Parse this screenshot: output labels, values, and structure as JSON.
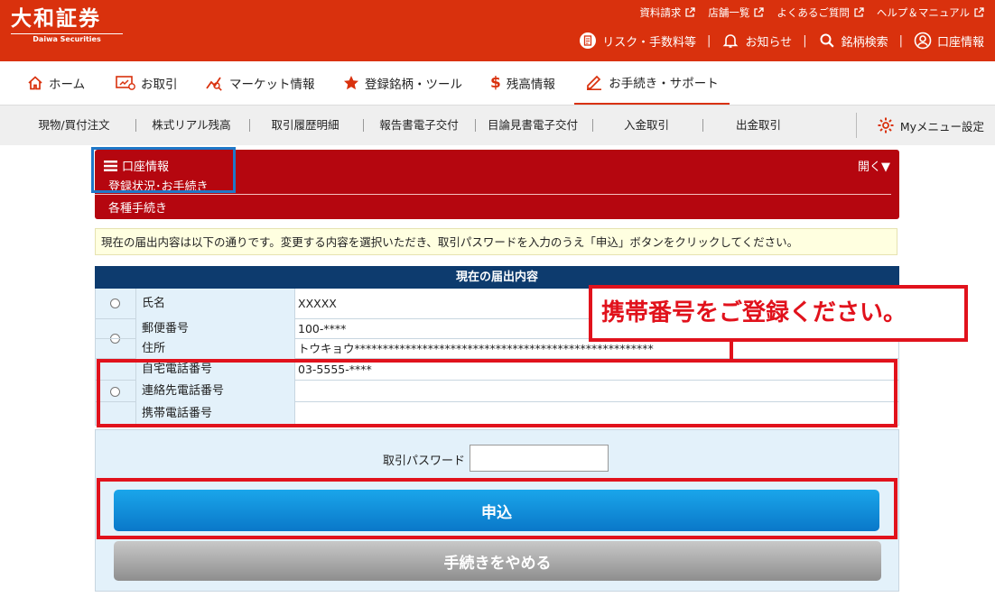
{
  "brand": {
    "name_jp": "大和証券",
    "name_en": "Daiwa Securities"
  },
  "header": {
    "top_links": [
      "資料請求",
      "店舗一覧",
      "よくあるご質問",
      "ヘルプ＆マニュアル"
    ],
    "utils": {
      "risk": "リスク・手数料等",
      "notice": "お知らせ",
      "search": "銘柄検索",
      "account": "口座情報"
    }
  },
  "nav": {
    "items": [
      {
        "label": "ホーム",
        "icon": "home-icon"
      },
      {
        "label": "お取引",
        "icon": "trade-icon"
      },
      {
        "label": "マーケット情報",
        "icon": "market-icon"
      },
      {
        "label": "登録銘柄・ツール",
        "icon": "star-icon"
      },
      {
        "label": "残高情報",
        "icon": "dollar-icon"
      },
      {
        "label": "お手続き・サポート",
        "icon": "pencil-icon"
      }
    ]
  },
  "subnav": {
    "items": [
      "現物/買付注文",
      "株式リアル残高",
      "取引履歴明細",
      "報告書電子交付",
      "目論見書電子交付",
      "入金取引",
      "出金取引"
    ],
    "mymenu": "Myメニュー設定"
  },
  "account_panel": {
    "title": "口座情報",
    "sub1": "登録状況･お手続き",
    "sub2": "各種手続き",
    "open_label": "開く▼"
  },
  "notice_text": "現在の届出内容は以下の通りです。変更する内容を選択いただき、取引パスワードを入力のうえ「申込」ボタンをクリックしてください。",
  "table": {
    "header": "現在の届出内容",
    "name": {
      "label": "氏名",
      "value": "XXXXX"
    },
    "postal": {
      "label": "郵便番号",
      "value": "100-****"
    },
    "address": {
      "label": "住所",
      "value": "トウキョウ*****************************************************"
    },
    "home_phone": {
      "label": "自宅電話番号",
      "value": "03-5555-****"
    },
    "contact_phone": {
      "label": "連絡先電話番号",
      "value": ""
    },
    "mobile_phone": {
      "label": "携帯電話番号",
      "value": ""
    }
  },
  "callout": "携帯番号をご登録ください。",
  "form": {
    "password_label": "取引パスワード",
    "password_value": "",
    "submit_label": "申込",
    "cancel_label": "手続きをやめる"
  },
  "colors": {
    "brand_red": "#d9310d",
    "panel_red": "#b5060f",
    "table_head": "#0d3b6e",
    "highlight_red": "#e1121c",
    "highlight_blue": "#1f78c8",
    "submit_blue": "#0a78c9"
  }
}
